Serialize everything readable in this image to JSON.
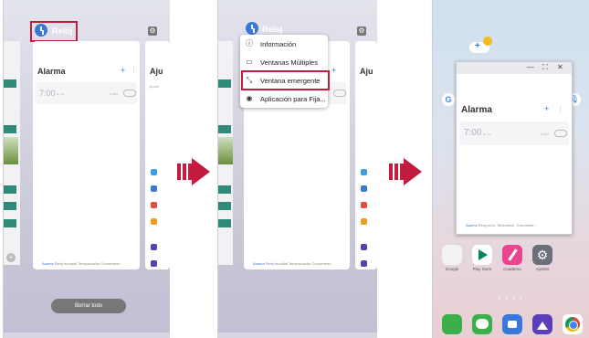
{
  "app": {
    "name": "Reloj",
    "title": "Alarma",
    "alarm_time": "7:00",
    "ampm": "a. m.",
    "alarm_sub": "1 min",
    "tabs": [
      "Alarma",
      "Reloj mundial",
      "Temporizador",
      "Cronómetro"
    ],
    "tabs_short": [
      "Alarma",
      "Reloj mun.",
      "Temporiza..",
      "Cronómetr.."
    ]
  },
  "panel1": {
    "clear_button": "Borrar todo",
    "right_card_title": "Aju",
    "right_card_hint": "Ajuste"
  },
  "panel2": {
    "menu": [
      {
        "icon": "info-icon",
        "glyph": "ⓘ",
        "label": "Información"
      },
      {
        "icon": "multi-window-icon",
        "glyph": "▭",
        "label": "Ventanas Múltiples"
      },
      {
        "icon": "popup-window-icon",
        "glyph": "⤡",
        "label": "Ventana emergente"
      },
      {
        "icon": "pin-icon",
        "glyph": "◉",
        "label": "Aplicación para Fija..."
      }
    ],
    "right_card_title": "Aju"
  },
  "panel3": {
    "window_controls": [
      "—",
      "⛶",
      "✕"
    ],
    "apps": [
      {
        "label": "Google",
        "color": "#f2f2f2"
      },
      {
        "label": "Play Store",
        "color": "#ffffff"
      },
      {
        "label": "Cuaderno",
        "color": "#e8458e"
      },
      {
        "label": "Ajustes",
        "color": "#6b6f7a"
      }
    ],
    "dock": [
      {
        "name": "phone-icon",
        "color": "#3bb04a"
      },
      {
        "name": "messages-icon",
        "color": "#3bb04a"
      },
      {
        "name": "camera-icon",
        "color": "#3a78d8"
      },
      {
        "name": "gallery-icon",
        "color": "#5a3fb8"
      },
      {
        "name": "chrome-icon",
        "color": "#ffffff"
      }
    ]
  },
  "colors": {
    "accent": "#3a78d8",
    "highlight": "#c21d3e"
  }
}
